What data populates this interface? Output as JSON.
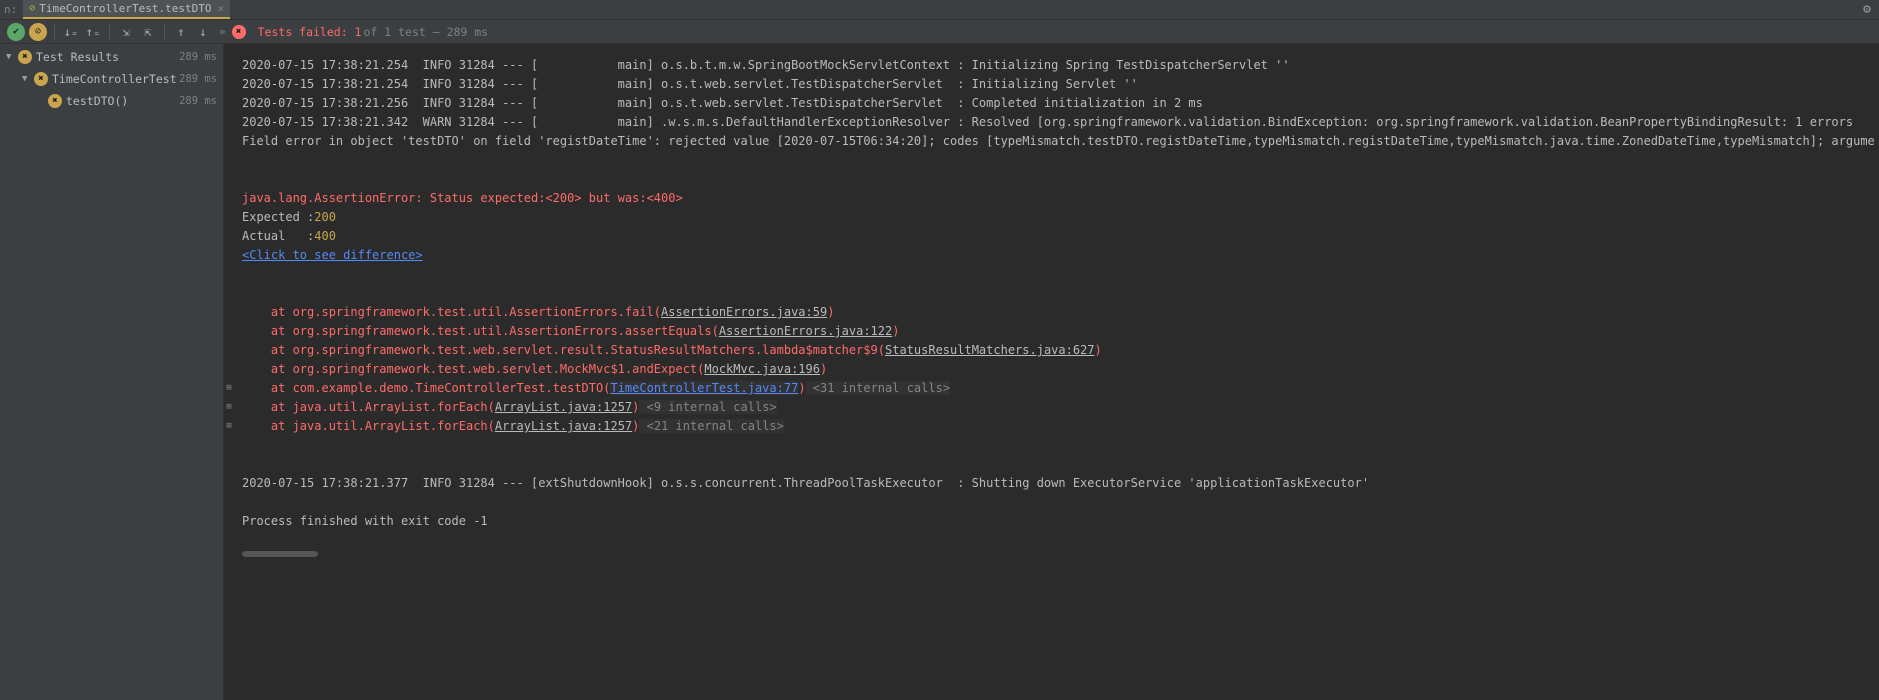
{
  "tab": {
    "prefix": "n:",
    "title": "TimeControllerTest.testDTO",
    "close": "×"
  },
  "toolbar": {
    "icons": {
      "sort_asc": "↓₌",
      "sort_desc": "↑₌",
      "expand": "⇲",
      "collapse": "⇱",
      "up": "↑",
      "down": "↓",
      "chev": "»"
    },
    "status_fail": "Tests failed: 1",
    "status_tail": " of 1 test – 289 ms"
  },
  "tree": {
    "root": {
      "label": "Test Results",
      "time": "289 ms"
    },
    "level1": {
      "label": "TimeControllerTest",
      "time": "289 ms"
    },
    "level2": {
      "label": "testDTO()",
      "time": "289 ms"
    }
  },
  "log": {
    "pre": [
      "2020-07-15 17:38:21.254  INFO 31284 --- [           main] o.s.b.t.m.w.SpringBootMockServletContext : Initializing Spring TestDispatcherServlet ''",
      "2020-07-15 17:38:21.254  INFO 31284 --- [           main] o.s.t.web.servlet.TestDispatcherServlet  : Initializing Servlet ''",
      "2020-07-15 17:38:21.256  INFO 31284 --- [           main] o.s.t.web.servlet.TestDispatcherServlet  : Completed initialization in 2 ms",
      "2020-07-15 17:38:21.342  WARN 31284 --- [           main] .w.s.m.s.DefaultHandlerExceptionResolver : Resolved [org.springframework.validation.BindException: org.springframework.validation.BeanPropertyBindingResult: 1 errors",
      "Field error in object 'testDTO' on field 'registDateTime': rejected value [2020-07-15T06:34:20]; codes [typeMismatch.testDTO.registDateTime,typeMismatch.registDateTime,typeMismatch.java.time.ZonedDateTime,typeMismatch]; argume"
    ],
    "err_line": "java.lang.AssertionError: Status expected:<200> but was:<400>",
    "expected_label": "Expected :",
    "expected_val": "200",
    "actual_label": "Actual   :",
    "actual_val": "400",
    "diff_link": "<Click to see difference>",
    "stack": [
      {
        "pre": "    at org.springframework.test.util.AssertionErrors.fail(",
        "link": "AssertionErrors.java:59",
        "post": ")"
      },
      {
        "pre": "    at org.springframework.test.util.AssertionErrors.assertEquals(",
        "link": "AssertionErrors.java:122",
        "post": ")"
      },
      {
        "pre": "    at org.springframework.test.web.servlet.result.StatusResultMatchers.lambda$matcher$9(",
        "link": "StatusResultMatchers.java:627",
        "post": ")"
      },
      {
        "pre": "    at org.springframework.test.web.servlet.MockMvc$1.andExpect(",
        "link": "MockMvc.java:196",
        "post": ")"
      },
      {
        "pre": "    at com.example.demo.TimeControllerTest.testDTO(",
        "link": "TimeControllerTest.java:77",
        "post": ")",
        "hint": " <31 internal calls>",
        "gutter": true,
        "own": true
      },
      {
        "pre": "    at java.util.ArrayList.forEach(",
        "link": "ArrayList.java:1257",
        "post": ")",
        "hint": " <9 internal calls>",
        "gutter": true
      },
      {
        "pre": "    at java.util.ArrayList.forEach(",
        "link": "ArrayList.java:1257",
        "post": ")",
        "hint": " <21 internal calls>",
        "gutter": true
      }
    ],
    "post1": "2020-07-15 17:38:21.377  INFO 31284 --- [extShutdownHook] o.s.s.concurrent.ThreadPoolTaskExecutor  : Shutting down ExecutorService 'applicationTaskExecutor'",
    "post2": "Process finished with exit code -1"
  }
}
